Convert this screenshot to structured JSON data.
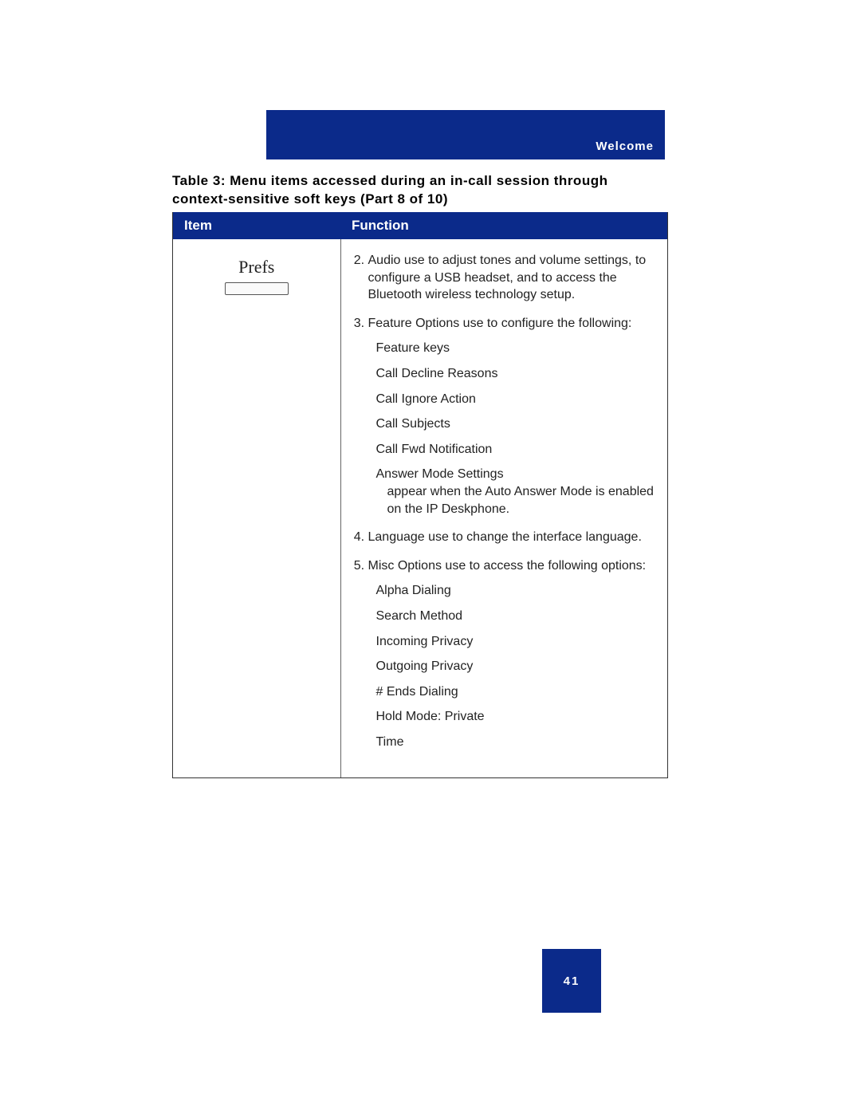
{
  "header": {
    "section_label": "Welcome"
  },
  "caption": "Table 3: Menu items accessed during an in-call session through context-sensitive soft keys (Part 8 of 10)",
  "table": {
    "headers": {
      "item": "Item",
      "function": "Function"
    },
    "row": {
      "item_label": "Prefs",
      "functions": {
        "start_number": 2,
        "items": [
          {
            "text": "Audio use to adjust tones and volume settings, to configure a USB headset, and to access the Bluetooth wireless technology setup."
          },
          {
            "text": "Feature Options use to configure the following:",
            "sub": [
              "Feature keys",
              "Call Decline Reasons",
              "Call Ignore Action",
              "Call Subjects",
              "Call Fwd Notification",
              {
                "text": "Answer Mode Settings",
                "cont": "appear when the Auto Answer Mode is enabled on the IP Deskphone."
              }
            ]
          },
          {
            "text": "Language use to change the interface language."
          },
          {
            "text": "Misc Options use to access the following options:",
            "sub": [
              "Alpha Dialing",
              "Search Method",
              "Incoming Privacy",
              "Outgoing Privacy",
              "# Ends Dialing",
              "Hold Mode: Private",
              "Time"
            ]
          }
        ]
      }
    }
  },
  "page_number": "41"
}
